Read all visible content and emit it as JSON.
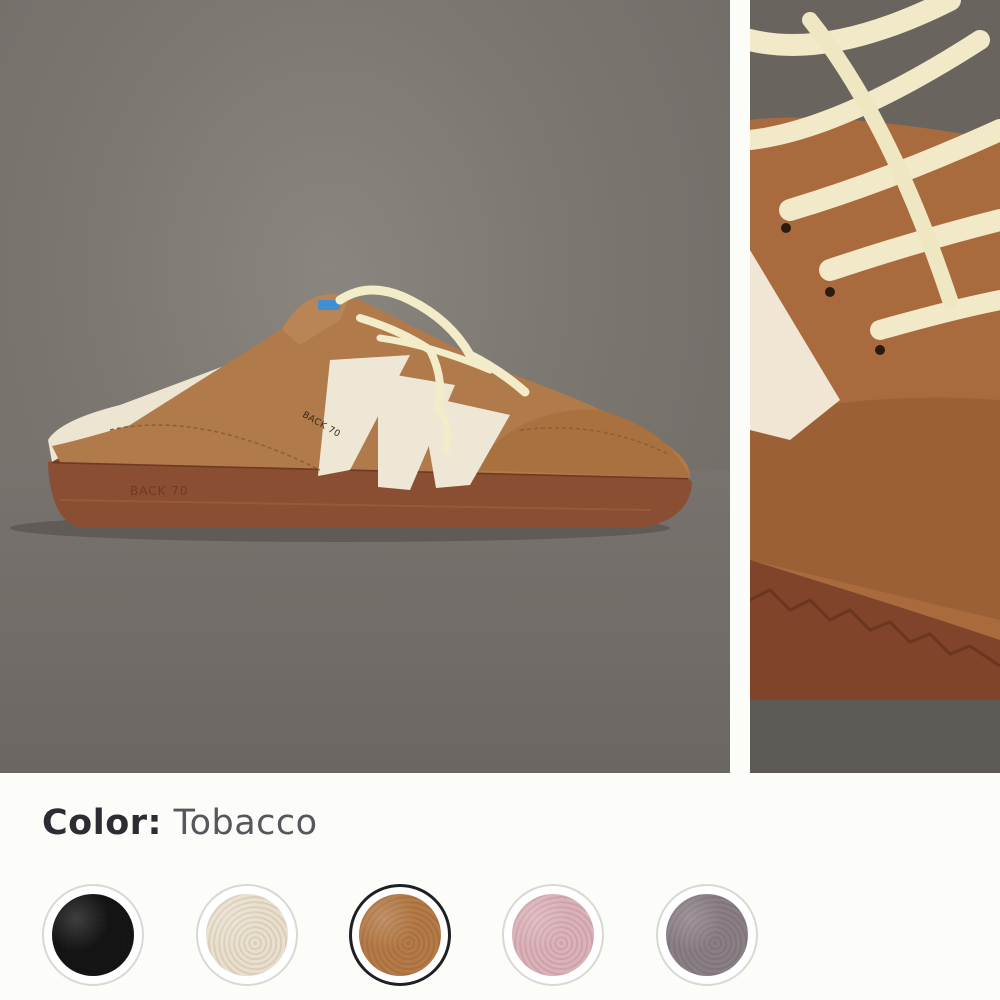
{
  "gallery": {
    "main_image_alt": "Tobacco suede backless sneaker mule with cream sherpa stripes",
    "detail_image_alt": "Close-up of cream laces and suede upper",
    "brand_mark": "BACK 70"
  },
  "color_selector": {
    "label": "Color:",
    "selected_value": "Tobacco",
    "swatches": [
      {
        "name": "Black",
        "color": "#151515"
      },
      {
        "name": "Cream",
        "color": "#e9dfcc"
      },
      {
        "name": "Tobacco",
        "color": "#b57a45"
      },
      {
        "name": "Pink",
        "color": "#dcb1b9"
      },
      {
        "name": "Metallic",
        "color": "#8b7f86"
      }
    ]
  }
}
